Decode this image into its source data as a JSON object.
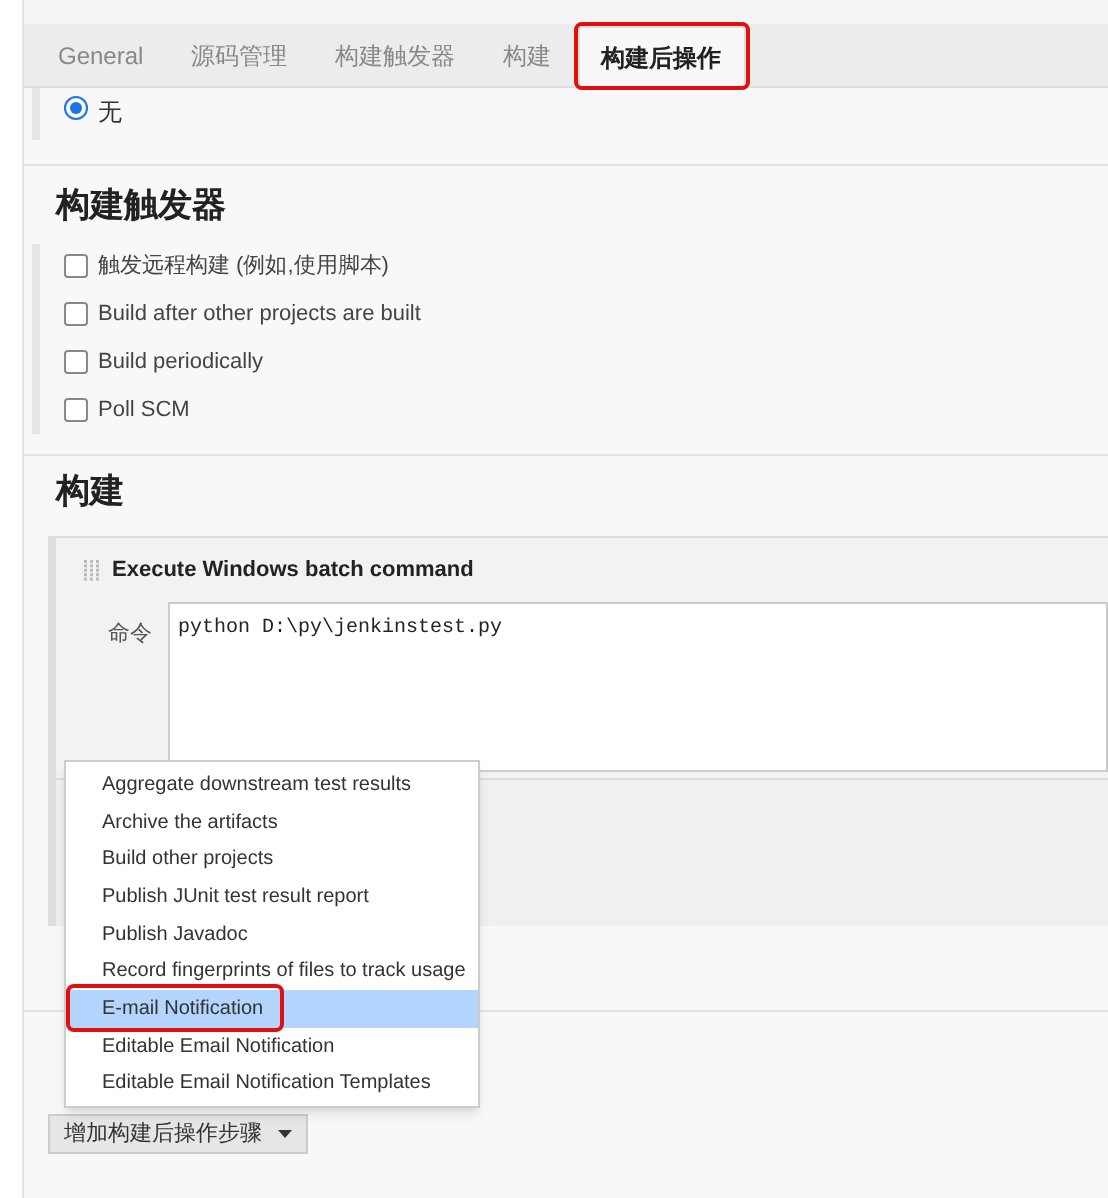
{
  "tabs": [
    {
      "label": "General",
      "selected": false,
      "highlighted": false
    },
    {
      "label": "源码管理",
      "selected": false,
      "highlighted": false
    },
    {
      "label": "构建触发器",
      "selected": false,
      "highlighted": false
    },
    {
      "label": "构建",
      "selected": false,
      "highlighted": false
    },
    {
      "label": "构建后操作",
      "selected": true,
      "highlighted": true
    }
  ],
  "radio": {
    "label": "无",
    "selected": true
  },
  "triggers": {
    "title": "构建触发器",
    "options": [
      {
        "label": "触发远程构建 (例如,使用脚本)",
        "checked": false
      },
      {
        "label": "Build after other projects are built",
        "checked": false
      },
      {
        "label": "Build periodically",
        "checked": false
      },
      {
        "label": "Poll SCM",
        "checked": false
      }
    ]
  },
  "build": {
    "title": "构建",
    "step": {
      "title": "Execute Windows batch command",
      "field_label": "命令",
      "value": "python D:\\py\\jenkinstest.py"
    }
  },
  "menu": {
    "items": [
      {
        "label": "Aggregate downstream test results",
        "selected": false,
        "highlighted": false
      },
      {
        "label": "Archive the artifacts",
        "selected": false,
        "highlighted": false
      },
      {
        "label": "Build other projects",
        "selected": false,
        "highlighted": false
      },
      {
        "label": "Publish JUnit test result report",
        "selected": false,
        "highlighted": false
      },
      {
        "label": "Publish Javadoc",
        "selected": false,
        "highlighted": false
      },
      {
        "label": "Record fingerprints of files to track usage",
        "selected": false,
        "highlighted": false
      },
      {
        "label": "E-mail Notification",
        "selected": true,
        "highlighted": true
      },
      {
        "label": "Editable Email Notification",
        "selected": false,
        "highlighted": false
      },
      {
        "label": "Editable Email Notification Templates",
        "selected": false,
        "highlighted": false
      }
    ]
  },
  "add_button": {
    "label": "增加构建后操作步骤"
  }
}
